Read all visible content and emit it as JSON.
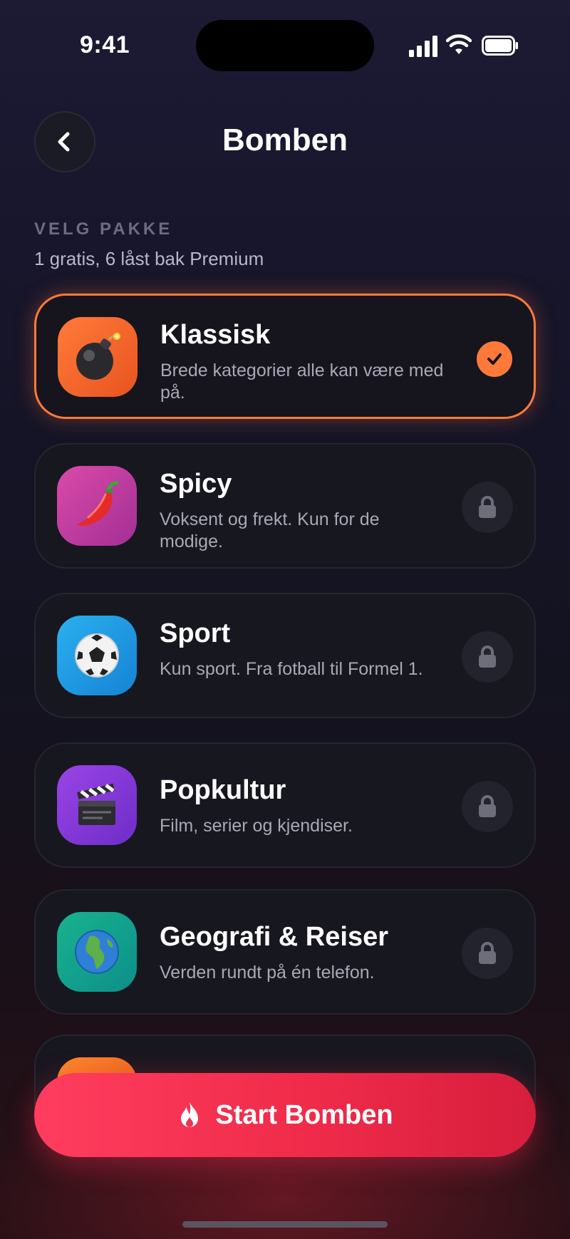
{
  "status_bar": {
    "time": "9:41"
  },
  "header": {
    "title": "Bomben",
    "back_icon": "chevron-left-icon"
  },
  "section": {
    "label": "VELG PAKKE",
    "subtitle": "1 gratis, 6 låst bak Premium"
  },
  "packs": [
    {
      "title": "Klassisk",
      "description": "Brede kategorier alle kan være med på.",
      "icon": "bomb-icon",
      "state": "selected",
      "color": "#ff6a2a"
    },
    {
      "title": "Spicy",
      "description": "Voksent og frekt. Kun for de modige.",
      "icon": "chili-pepper-icon",
      "state": "locked",
      "color": "#c43aa8"
    },
    {
      "title": "Sport",
      "description": "Kun sport. Fra fotball til Formel 1.",
      "icon": "soccer-ball-icon",
      "state": "locked",
      "color": "#1f9be6"
    },
    {
      "title": "Popkultur",
      "description": "Film, serier og kjendiser.",
      "icon": "clapperboard-icon",
      "state": "locked",
      "color": "#8a3adf"
    },
    {
      "title": "Geografi & Reiser",
      "description": "Verden rundt på én telefon.",
      "icon": "globe-icon",
      "state": "locked",
      "color": "#12a88a"
    }
  ],
  "cta": {
    "label": "Start Bomben",
    "icon": "flame-icon",
    "color": "#f0324f"
  },
  "colors": {
    "accent": "#ff7a3a",
    "background": "#15141f",
    "card": "#17171f"
  }
}
